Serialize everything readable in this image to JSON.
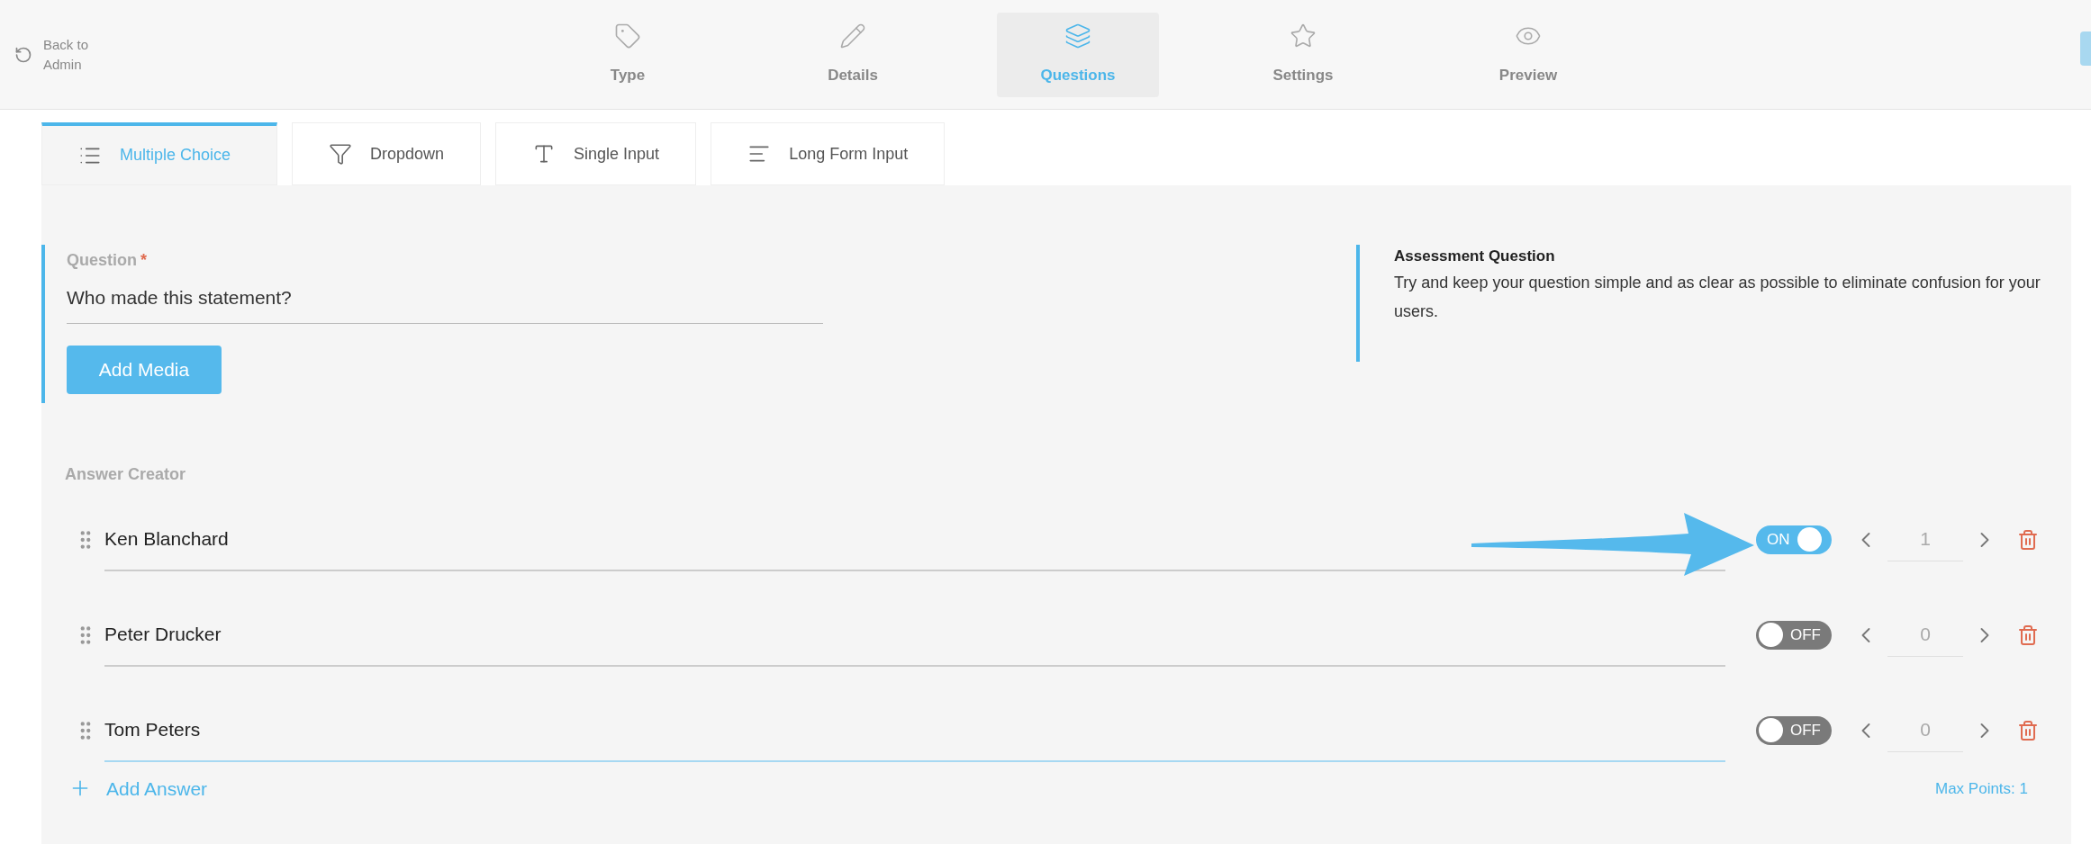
{
  "back_link": {
    "label": "Back to Admin"
  },
  "steps": [
    {
      "label": "Type",
      "selected": false
    },
    {
      "label": "Details",
      "selected": false
    },
    {
      "label": "Questions",
      "selected": true
    },
    {
      "label": "Settings",
      "selected": false
    },
    {
      "label": "Preview",
      "selected": false
    }
  ],
  "question_types": [
    {
      "label": "Multiple Choice",
      "selected": true
    },
    {
      "label": "Dropdown",
      "selected": false
    },
    {
      "label": "Single Input",
      "selected": false
    },
    {
      "label": "Long Form Input",
      "selected": false
    }
  ],
  "question": {
    "label": "Question",
    "required_mark": "*",
    "value": "Who made this statement?",
    "add_media": "Add Media"
  },
  "help": {
    "title": "Assessment Question",
    "text": "Try and keep your question simple and as clear as possible to eliminate confusion for your users."
  },
  "answer_creator": {
    "title": "Answer Creator",
    "answers": [
      {
        "text": "Ken Blanchard",
        "focused": false,
        "correct": {
          "on": true,
          "label": "ON"
        },
        "points": "1"
      },
      {
        "text": "Peter Drucker",
        "focused": false,
        "correct": {
          "on": false,
          "label": "OFF"
        },
        "points": "0"
      },
      {
        "text": "Tom Peters",
        "focused": true,
        "correct": {
          "on": false,
          "label": "OFF"
        },
        "points": "0"
      }
    ],
    "add_answer": "Add Answer",
    "max_points": "Max Points: 1"
  }
}
